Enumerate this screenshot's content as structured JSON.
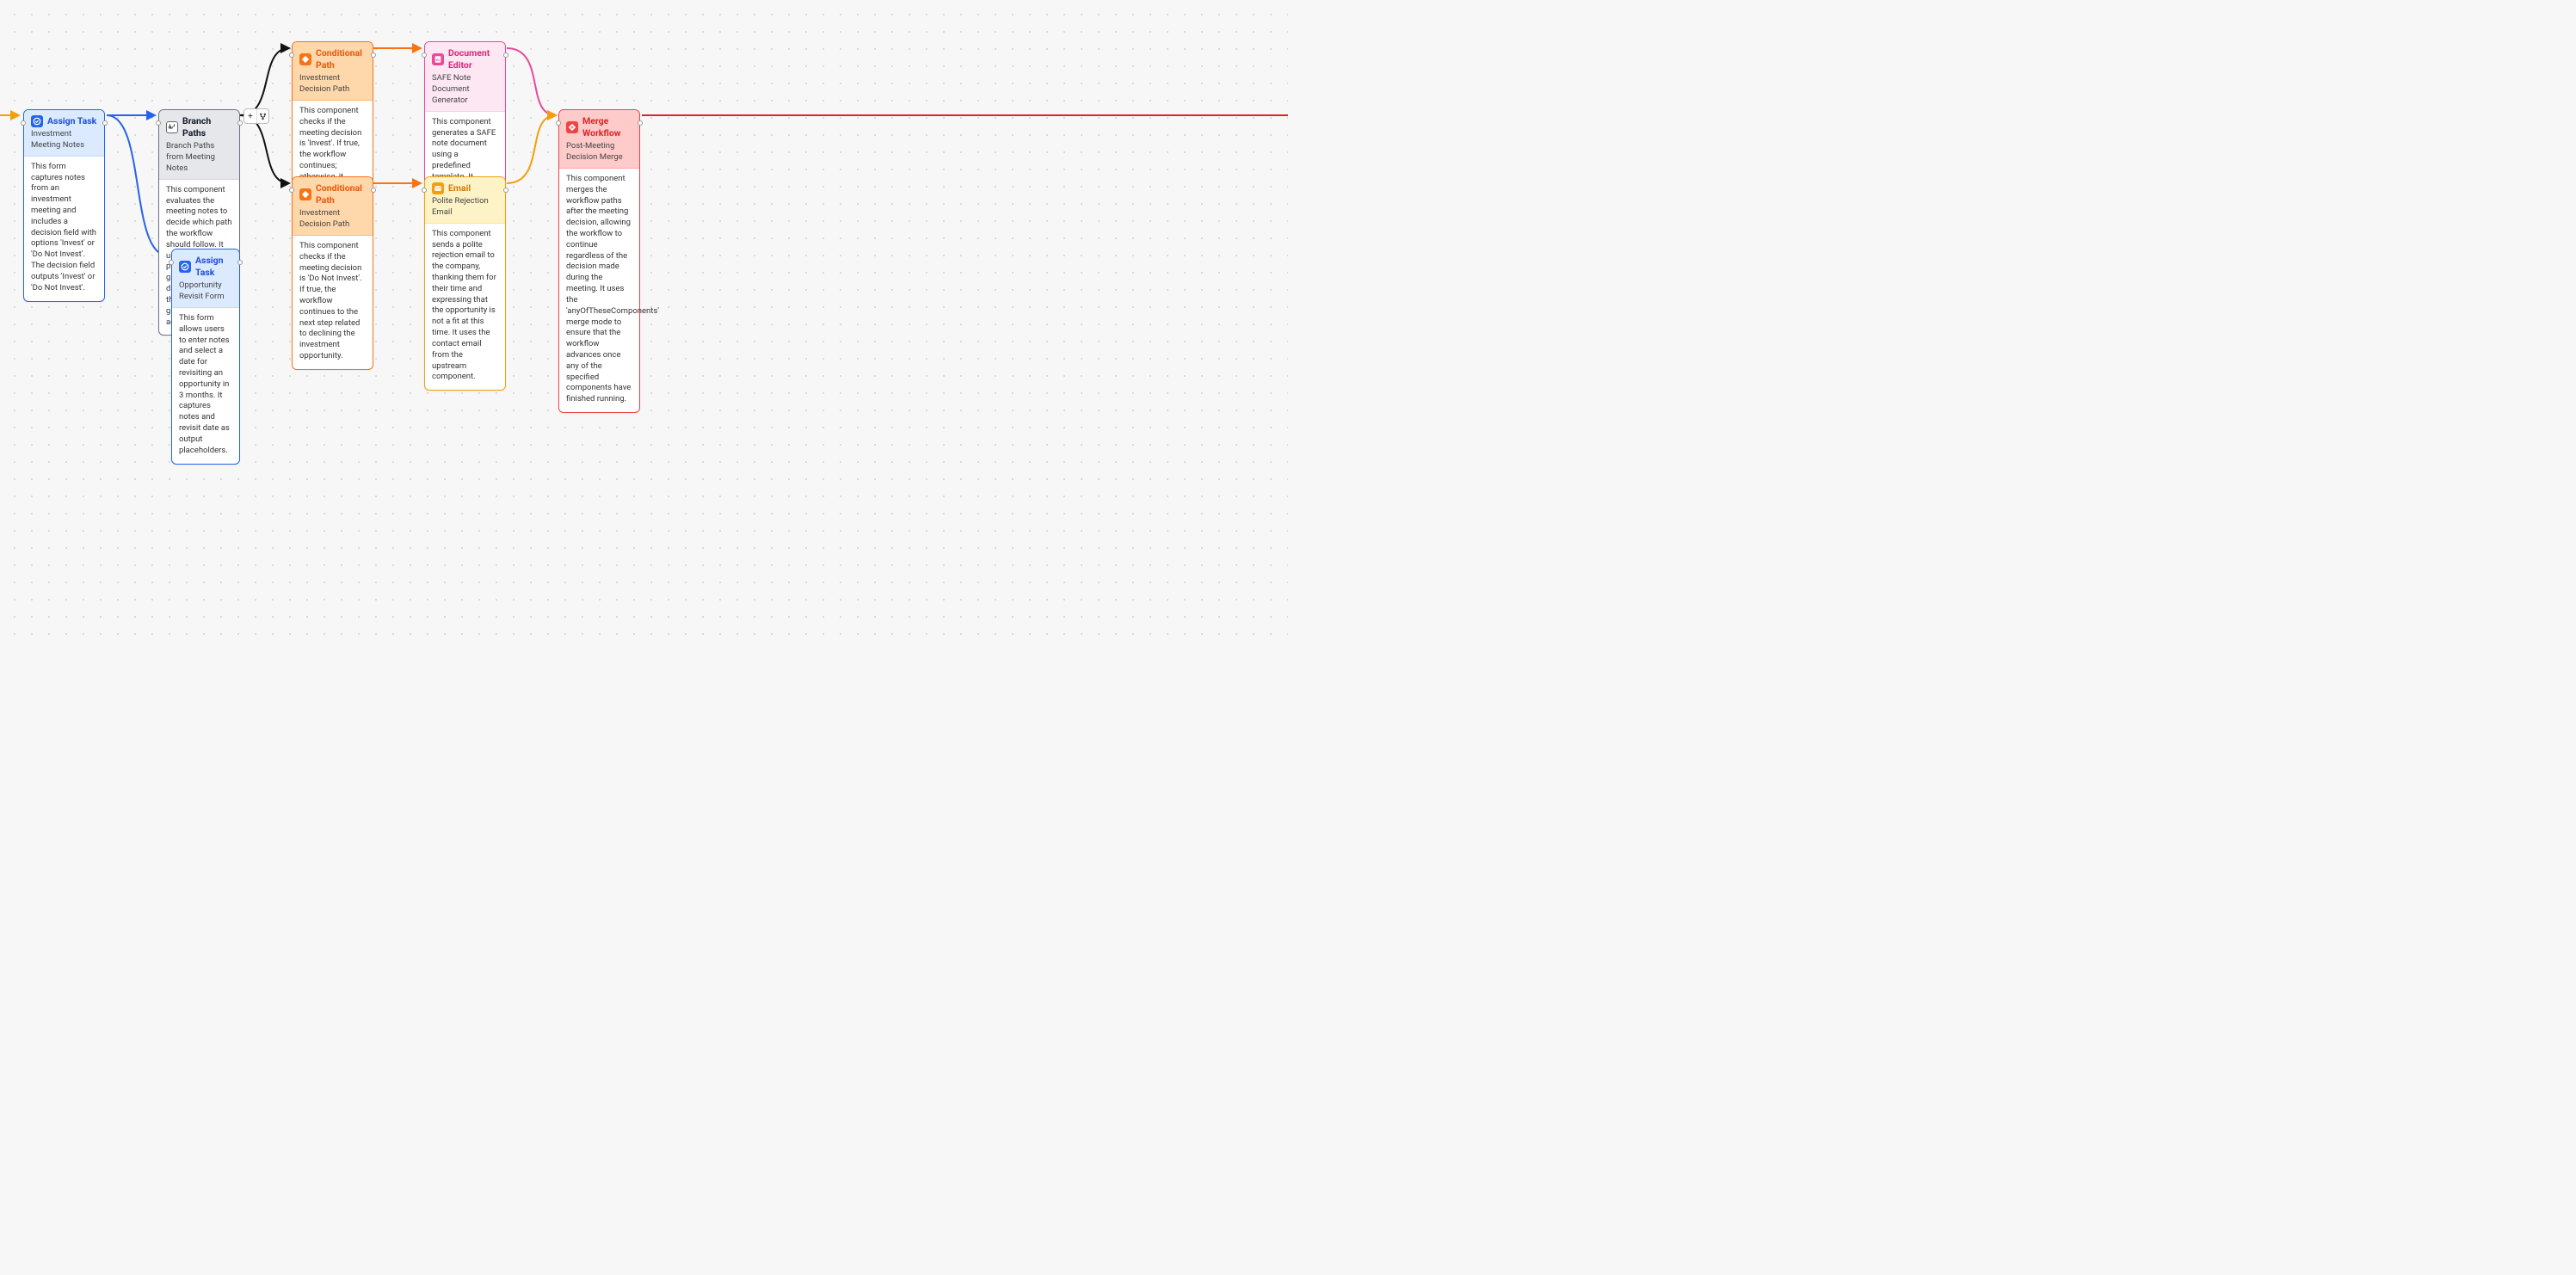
{
  "nodes": {
    "assign1": {
      "title": "Assign Task",
      "subtitle": "Investment Meeting Notes",
      "body": "This form captures notes from an investment meeting and includes a decision field with options 'Invest' or 'Do Not Invest'. The decision field outputs 'Invest' or 'Do Not Invest'."
    },
    "branch": {
      "title": "Branch Paths",
      "subtitle": "Branch Paths from Meeting Notes",
      "body": "This component evaluates the meeting notes to decide which path the workflow should follow. It uses the input placeholders to gather necessary data and outputs the decision to guide subsequent actions."
    },
    "assign2": {
      "title": "Assign Task",
      "subtitle": "Opportunity Revisit Form",
      "body": "This form allows users to enter notes and select a date for revisiting an opportunity in 3 months. It captures notes and revisit date as output placeholders."
    },
    "cond1": {
      "title": "Conditional Path",
      "subtitle": "Investment Decision Path",
      "body": "This component checks if the meeting decision is 'Invest'. If true, the workflow continues; otherwise, it stops."
    },
    "cond2": {
      "title": "Conditional Path",
      "subtitle": "Investment Decision Path",
      "body": "This component checks if the meeting decision is 'Do Not Invest'. If true, the workflow continues to the next step related to declining the investment opportunity."
    },
    "doc": {
      "title": "Document Editor",
      "subtitle": "SAFE Note Document Generator",
      "body": "This component generates a SAFE note document using a predefined template. It incorporates input placeholders to customize the document and outputs a URL for the generated document."
    },
    "email": {
      "title": "Email",
      "subtitle": "Polite Rejection Email",
      "body": "This component sends a polite rejection email to the company, thanking them for their time and expressing that the opportunity is not a fit at this time. It uses the contact email from the upstream component."
    },
    "merge": {
      "title": "Merge Workflow",
      "subtitle": "Post-Meeting Decision Merge",
      "body": "This component merges the workflow paths after the meeting decision, allowing the workflow to continue regardless of the decision made during the meeting. It uses the 'anyOfTheseComponents' merge mode to ensure that the workflow advances once any of the specified components have finished running."
    }
  },
  "add_branch": {
    "plus": "+",
    "fork": "⑂"
  }
}
